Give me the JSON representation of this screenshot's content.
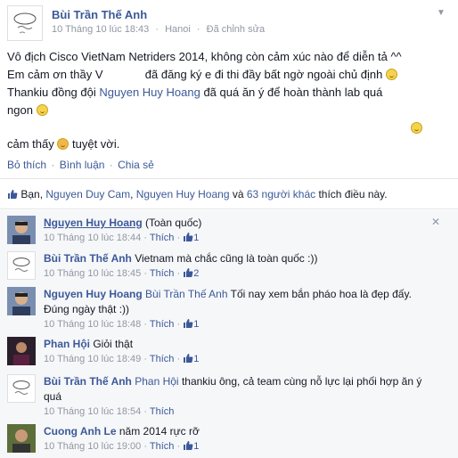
{
  "post": {
    "author": "Bùi Trần Thế Anh",
    "time": "10 Tháng 10 lúc 18:43",
    "location": "Hanoi",
    "edited": "Đã chỉnh sửa",
    "line1": "Vô địch Cisco VietNam Netriders 2014, không còn cảm xúc nào để diễn tả ^^",
    "line2a": "Em cảm ơn thầy V",
    "line2b": "đã đăng ký e đi thi đầy bất ngờ ngoài chủ định",
    "line3a": "Thankiu đồng đội ",
    "line3_tag": "Nguyen Huy Hoang",
    "line3b": " đã quá ăn ý để hoàn thành lab quá",
    "line4": "ngon",
    "line5a": "cảm thấy",
    "line5b": "tuyệt vời."
  },
  "actions": {
    "like": "Bỏ thích",
    "comment": "Bình luận",
    "share": "Chia sẻ"
  },
  "likes": {
    "prefix": "Bạn, ",
    "name1": "Nguyen Duy Cam",
    "name2": "Nguyen Huy Hoang",
    "and": " và ",
    "others": "63 người khác",
    "suffix": " thích điều này."
  },
  "comments": [
    {
      "name": "Nguyen Huy Hoang",
      "text": " (Toàn quốc)",
      "time": "10 Tháng 10 lúc 18:44",
      "action": "Thích",
      "likes": "1"
    },
    {
      "name": "Bùi Trần Thế Anh",
      "text": " Vietnam mà chắc cũng là toàn quốc :))",
      "time": "10 Tháng 10 lúc 18:45",
      "action": "Thích",
      "likes": "2"
    },
    {
      "name": "Nguyen Huy Hoang",
      "tag": "Bùi Trần Thế Anh",
      "text": " Tối nay xem bắn pháo hoa là đẹp đấy. Đúng ngày thật :))",
      "time": "10 Tháng 10 lúc 18:48",
      "action": "Thích",
      "likes": "1"
    },
    {
      "name": "Phan Hội",
      "text": " Giỏi thật",
      "time": "10 Tháng 10 lúc 18:49",
      "action": "Thích",
      "likes": "1"
    },
    {
      "name": "Bùi Trần Thế Anh",
      "tag": "Phan Hội",
      "text": " thankiu ông, cả team cùng nỗ lực lại phối hợp ăn ý quá",
      "time": "10 Tháng 10 lúc 18:54",
      "action": "Thích",
      "likes": ""
    },
    {
      "name": "Cuong Anh Le",
      "text": " năm 2014 rực rỡ",
      "time": "10 Tháng 10 lúc 19:00",
      "action": "Thích",
      "likes": "1"
    }
  ],
  "colors": {
    "link": "#3b5998",
    "meta": "#9197a3",
    "emoji": "#f5d34e"
  },
  "sep": "·"
}
